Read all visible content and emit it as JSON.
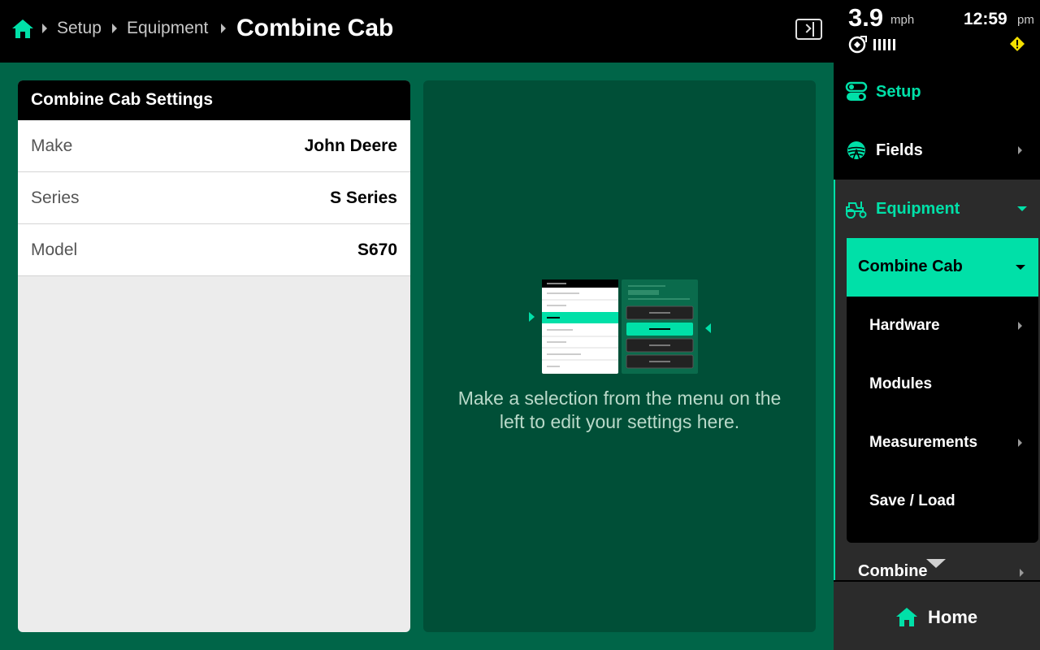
{
  "header": {
    "breadcrumbs": [
      "Setup",
      "Equipment"
    ],
    "title": "Combine Cab"
  },
  "settings": {
    "title": "Combine Cab Settings",
    "rows": [
      {
        "label": "Make",
        "value": "John Deere"
      },
      {
        "label": "Series",
        "value": "S Series"
      },
      {
        "label": "Model",
        "value": "S670"
      }
    ]
  },
  "center": {
    "hint": "Make a selection from the menu on the left to edit your settings here."
  },
  "status": {
    "speed": "3.9",
    "speed_unit": "mph",
    "time": "12:59",
    "ampm": "pm"
  },
  "sidebar": {
    "setup": "Setup",
    "fields": "Fields",
    "equipment": "Equipment",
    "active_sub": "Combine Cab",
    "sub_items": [
      "Hardware",
      "Modules",
      "Measurements",
      "Save / Load"
    ],
    "next_peek": "Combine",
    "home": "Home"
  },
  "colors": {
    "accent": "#00e0a8",
    "background": "#006548",
    "panel": "#004f37",
    "warning": "#f5e000"
  },
  "icons": [
    "home-icon",
    "breadcrumb-chevron-icon",
    "panel-toggle-icon",
    "gps-icon",
    "signal-icon",
    "warning-icon",
    "setup-toggle-icon",
    "fields-icon",
    "tractor-icon",
    "chevron-right-icon",
    "chevron-down-icon",
    "scroll-down-icon"
  ]
}
